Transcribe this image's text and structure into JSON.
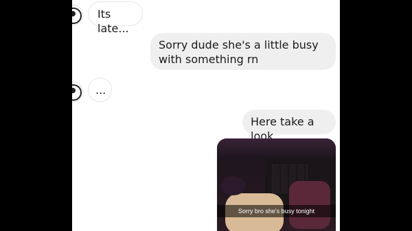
{
  "messages": [
    {
      "direction": "incoming",
      "text": "Its late..."
    },
    {
      "direction": "outgoing",
      "text": "Sorry dude she's a little busy with something rn"
    },
    {
      "direction": "incoming",
      "text": "..."
    },
    {
      "direction": "outgoing",
      "text": "Here take a look"
    }
  ],
  "photo": {
    "caption": "Sorry bro she's busy tonight"
  },
  "colors": {
    "outgoing_bubble": "#efefef",
    "incoming_bubble": "#ffffff",
    "background": "#ffffff",
    "letterbox": "#000000"
  }
}
